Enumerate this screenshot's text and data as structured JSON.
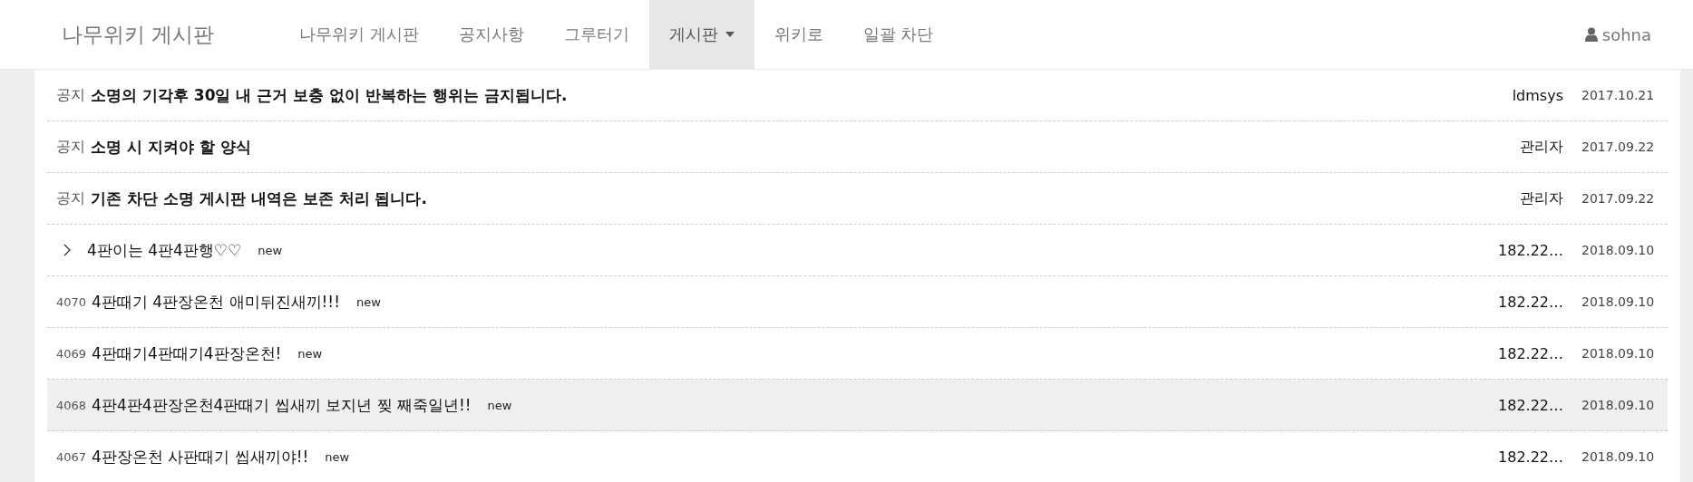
{
  "navbar": {
    "brand": "나무위키 게시판",
    "items": [
      {
        "label": "나무위키 게시판",
        "selected": false,
        "dropdown": false
      },
      {
        "label": "공지사항",
        "selected": false,
        "dropdown": false
      },
      {
        "label": "그루터기",
        "selected": false,
        "dropdown": false
      },
      {
        "label": "게시판",
        "selected": true,
        "dropdown": true
      },
      {
        "label": "위키로",
        "selected": false,
        "dropdown": false
      },
      {
        "label": "일괄 차단",
        "selected": false,
        "dropdown": false
      }
    ],
    "user": "sohna"
  },
  "posts": [
    {
      "kind": "notice",
      "prefix": "공지",
      "title": "소명의 기각후 30일 내 근거 보충 없이 반복하는 행위는 금지됩니다.",
      "author": "ldmsys",
      "date": "2017.10.21",
      "highlighted": false
    },
    {
      "kind": "notice",
      "prefix": "공지",
      "title": "소명 시 지켜야 할 양식",
      "author": "관리자",
      "date": "2017.09.22",
      "highlighted": false
    },
    {
      "kind": "notice",
      "prefix": "공지",
      "title": "기존 차단 소명 게시판 내역은 보존 처리 됩니다.",
      "author": "관리자",
      "date": "2017.09.22",
      "highlighted": false
    },
    {
      "kind": "reply",
      "title": "4판이는 4판4판행♡♡",
      "badge": "new",
      "author": "182.22…",
      "date": "2018.09.10",
      "highlighted": false
    },
    {
      "kind": "post",
      "number": "4070",
      "title": "4판때기 4판장온천 애미뒤진새끼!!!",
      "badge": "new",
      "author": "182.22…",
      "date": "2018.09.10",
      "highlighted": false
    },
    {
      "kind": "post",
      "number": "4069",
      "title": "4판때기4판때기4판장온천!",
      "badge": "new",
      "author": "182.22…",
      "date": "2018.09.10",
      "highlighted": false
    },
    {
      "kind": "post",
      "number": "4068",
      "title": "4판4판4판장온천4판때기 씹새끼 보지년 찢 째죽일년!!",
      "badge": "new",
      "author": "182.22…",
      "date": "2018.09.10",
      "highlighted": true
    },
    {
      "kind": "post",
      "number": "4067",
      "title": "4판장온천 사판때기 씹새끼야!!",
      "badge": "new",
      "author": "182.22…",
      "date": "2018.09.10",
      "highlighted": false
    }
  ]
}
